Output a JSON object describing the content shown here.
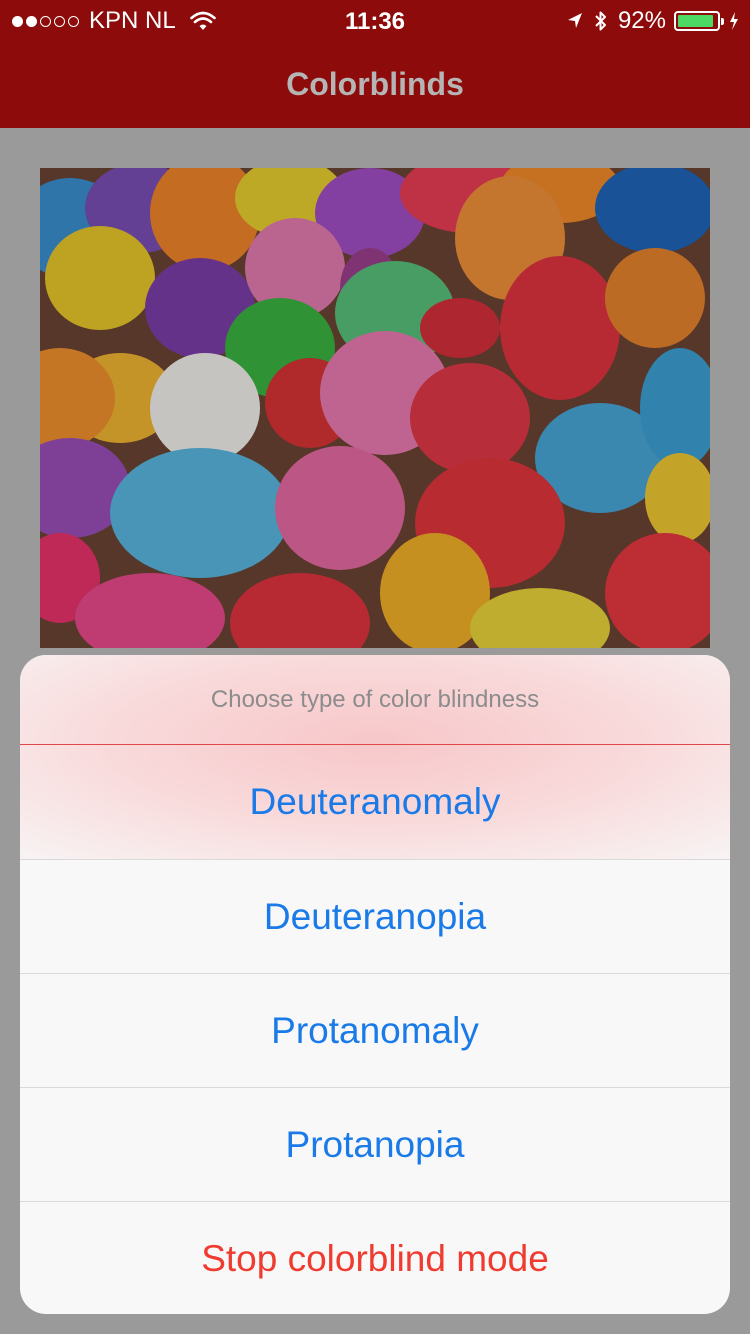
{
  "status_bar": {
    "carrier": "KPN NL",
    "time": "11:36",
    "battery_percent": "92%",
    "battery_level": 0.92,
    "signal_bars_filled": 2,
    "signal_bars_total": 5
  },
  "nav": {
    "title": "Colorblinds"
  },
  "photo": {
    "subject": "balloons photo"
  },
  "action_sheet": {
    "title": "Choose type of color blindness",
    "options": [
      {
        "label": "Deuteranomaly"
      },
      {
        "label": "Deuteranopia"
      },
      {
        "label": "Protanomaly"
      },
      {
        "label": "Protanopia"
      }
    ],
    "destructive_label": "Stop colorblind mode"
  },
  "colors": {
    "nav_background": "#8e0b0b",
    "action_blue": "#1a7ae8",
    "destructive_red": "#ef3b30",
    "battery_green": "#4cd964"
  },
  "icons": [
    "wifi-icon",
    "location-arrow-icon",
    "bluetooth-icon",
    "battery-icon",
    "charging-bolt-icon"
  ]
}
